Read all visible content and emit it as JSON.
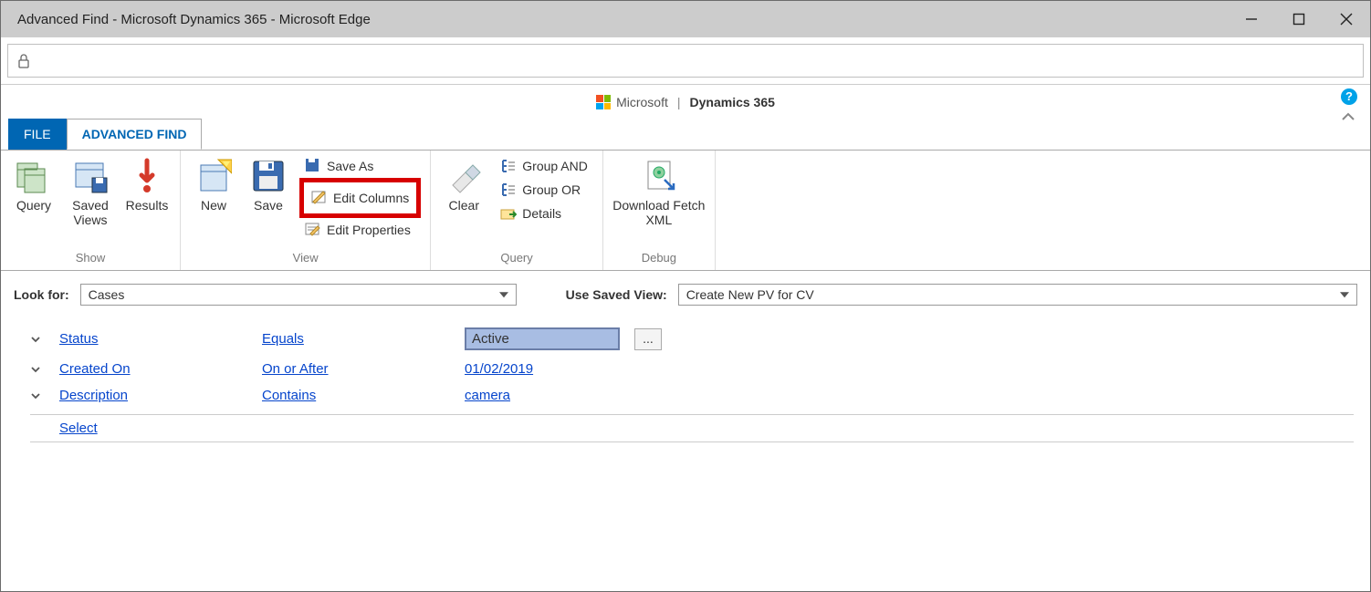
{
  "window": {
    "title": "Advanced Find - Microsoft Dynamics 365 - Microsoft Edge"
  },
  "brand": {
    "ms": "Microsoft",
    "product": "Dynamics 365"
  },
  "tabs": {
    "file": "FILE",
    "advanced": "ADVANCED FIND"
  },
  "ribbon": {
    "show": {
      "query": "Query",
      "savedViews": "Saved Views",
      "results": "Results",
      "label": "Show"
    },
    "view": {
      "new": "New",
      "save": "Save",
      "saveAs": "Save As",
      "editColumns": "Edit Columns",
      "editProperties": "Edit Properties",
      "label": "View"
    },
    "query": {
      "clear": "Clear",
      "groupAnd": "Group AND",
      "groupOr": "Group OR",
      "details": "Details",
      "label": "Query"
    },
    "debug": {
      "download": "Download Fetch XML",
      "label": "Debug"
    }
  },
  "form": {
    "lookFor": {
      "label": "Look for:",
      "value": "Cases"
    },
    "savedView": {
      "label": "Use Saved View:",
      "value": "Create New PV for CV"
    }
  },
  "criteria": [
    {
      "field": "Status",
      "operator": "Equals",
      "value": "Active",
      "valueType": "box"
    },
    {
      "field": "Created On",
      "operator": "On or After",
      "value": "01/02/2019",
      "valueType": "link"
    },
    {
      "field": "Description",
      "operator": "Contains",
      "value": "camera",
      "valueType": "link"
    }
  ],
  "selectLabel": "Select"
}
